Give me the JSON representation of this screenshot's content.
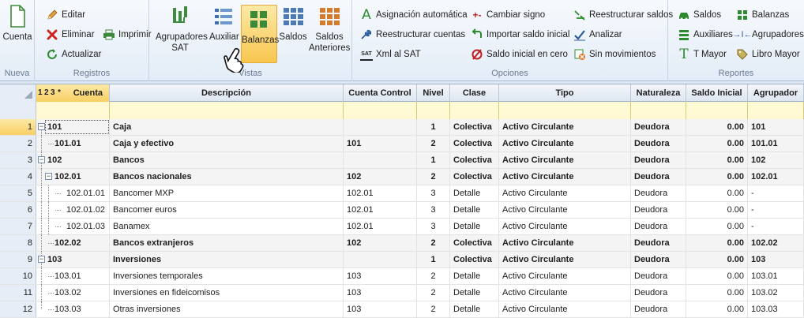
{
  "ribbon": {
    "nueva": {
      "label": "Nueva",
      "cuenta": "Cuenta"
    },
    "registros": {
      "label": "Registros",
      "editar": "Editar",
      "eliminar": "Eliminar",
      "imprimir": "Imprimir",
      "actualizar": "Actualizar"
    },
    "vistas": {
      "label": "Vistas",
      "agrupadores_sat": "Agrupadores SAT",
      "auxiliar": "Auxiliar",
      "balanzas": "Balanzas",
      "saldos": "Saldos",
      "saldos_anteriores": "Saldos Anteriores"
    },
    "opciones": {
      "label": "Opciones",
      "asignacion": "Asignación automática",
      "reestructurar_cuentas": "Reestructurar cuentas",
      "xml_sat": "Xml al SAT",
      "cambiar_signo": "Cambiar signo",
      "importar_saldo": "Importar saldo inicial",
      "saldo_cero": "Saldo inicial en cero",
      "reestructurar_saldos": "Reestructurar saldos",
      "analizar": "Analizar",
      "sin_movimientos": "Sin movimientos",
      "xml_badge": "SAT"
    },
    "reportes": {
      "label": "Reportes",
      "saldos": "Saldos",
      "balanzas": "Balanzas",
      "auxiliares": "Auxiliares",
      "agrupadores": "Agrupadores",
      "t_mayor": "T Mayor",
      "libro_mayor": "Libro Mayor"
    }
  },
  "grid": {
    "level_tabs": [
      "1",
      "2",
      "3",
      "*"
    ],
    "columns": {
      "cuenta": "Cuenta",
      "descripcion": "Descripción",
      "cuenta_control": "Cuenta Control",
      "nivel": "Nivel",
      "clase": "Clase",
      "tipo": "Tipo",
      "naturaleza": "Naturaleza",
      "saldo_inicial": "Saldo Inicial",
      "agrupador": "Agrupador"
    },
    "rows": [
      {
        "n": "1",
        "cuenta": "101",
        "desc": "Caja",
        "control": "",
        "nivel": "1",
        "clase": "Colectiva",
        "tipo": "Activo Circulante",
        "nat": "Deudora",
        "saldo": "0.00",
        "agr": "101"
      },
      {
        "n": "2",
        "cuenta": "101.01",
        "desc": "Caja y efectivo",
        "control": "101",
        "nivel": "2",
        "clase": "Colectiva",
        "tipo": "Activo Circulante",
        "nat": "Deudora",
        "saldo": "0.00",
        "agr": "101.01"
      },
      {
        "n": "3",
        "cuenta": "102",
        "desc": "Bancos",
        "control": "",
        "nivel": "1",
        "clase": "Colectiva",
        "tipo": "Activo Circulante",
        "nat": "Deudora",
        "saldo": "0.00",
        "agr": "102"
      },
      {
        "n": "4",
        "cuenta": "102.01",
        "desc": "Bancos nacionales",
        "control": "102",
        "nivel": "2",
        "clase": "Colectiva",
        "tipo": "Activo Circulante",
        "nat": "Deudora",
        "saldo": "0.00",
        "agr": "102.01"
      },
      {
        "n": "5",
        "cuenta": "102.01.01",
        "desc": "Bancomer MXP",
        "control": "102.01",
        "nivel": "3",
        "clase": "Detalle",
        "tipo": "Activo Circulante",
        "nat": "Deudora",
        "saldo": "0.00",
        "agr": "-"
      },
      {
        "n": "6",
        "cuenta": "102.01.02",
        "desc": "Bancomer euros",
        "control": "102.01",
        "nivel": "3",
        "clase": "Detalle",
        "tipo": "Activo Circulante",
        "nat": "Deudora",
        "saldo": "0.00",
        "agr": "-"
      },
      {
        "n": "7",
        "cuenta": "102.01.03",
        "desc": "Banamex",
        "control": "102.01",
        "nivel": "3",
        "clase": "Detalle",
        "tipo": "Activo Circulante",
        "nat": "Deudora",
        "saldo": "0.00",
        "agr": "-"
      },
      {
        "n": "8",
        "cuenta": "102.02",
        "desc": "Bancos extranjeros",
        "control": "102",
        "nivel": "2",
        "clase": "Colectiva",
        "tipo": "Activo Circulante",
        "nat": "Deudora",
        "saldo": "0.00",
        "agr": "102.02"
      },
      {
        "n": "9",
        "cuenta": "103",
        "desc": "Inversiones",
        "control": "",
        "nivel": "1",
        "clase": "Colectiva",
        "tipo": "Activo Circulante",
        "nat": "Deudora",
        "saldo": "0.00",
        "agr": "103"
      },
      {
        "n": "10",
        "cuenta": "103.01",
        "desc": "Inversiones temporales",
        "control": "103",
        "nivel": "2",
        "clase": "Detalle",
        "tipo": "Activo Circulante",
        "nat": "Deudora",
        "saldo": "0.00",
        "agr": "103.01"
      },
      {
        "n": "11",
        "cuenta": "103.02",
        "desc": "Inversiones en fideicomisos",
        "control": "103",
        "nivel": "2",
        "clase": "Detalle",
        "tipo": "Activo Circulante",
        "nat": "Deudora",
        "saldo": "0.00",
        "agr": "103.02"
      },
      {
        "n": "12",
        "cuenta": "103.03",
        "desc": "Otras inversiones",
        "control": "103",
        "nivel": "2",
        "clase": "Detalle",
        "tipo": "Activo Circulante",
        "nat": "Deudora",
        "saldo": "0.00",
        "agr": "103.03"
      }
    ]
  },
  "colors": {
    "accent": "#f8c64f",
    "filter_row": "#fffad3",
    "grid_header": "#dde6f1"
  }
}
